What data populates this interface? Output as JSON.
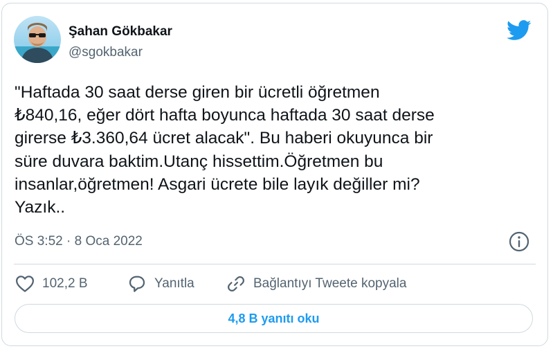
{
  "author": {
    "name": "Şahan Gökbakar",
    "handle": "@sgokbakar"
  },
  "tweet": {
    "text": "\"Haftada 30 saat derse giren bir ücretli öğretmen\n₺840,16, eğer dört hafta boyunca haftada 30 saat derse\ngirerse ₺3.360,64 ücret alacak\". Bu haberi okuyunca bir\nsüre duvara baktim.Utanç hissettim.Öğretmen bu\ninsanlar,öğretmen! Asgari ücrete bile layık değiller mi?\nYazık..",
    "timestamp": "ÖS 3:52 · 8 Oca 2022"
  },
  "actions": {
    "like_count": "102,2 B",
    "reply_label": "Yanıtla",
    "copy_link_label": "Bağlantıyı Tweete kopyala"
  },
  "read_replies_label": "4,8 B yanıtı oku",
  "icons": {
    "brand": "twitter-bird-icon",
    "info": "info-icon",
    "like": "heart-icon",
    "reply": "speech-bubble-icon",
    "copy": "link-icon"
  },
  "colors": {
    "twitter_blue": "#1d9bf0",
    "secondary_text": "#536471",
    "primary_text": "#0f1419",
    "border": "#cfd9de"
  }
}
